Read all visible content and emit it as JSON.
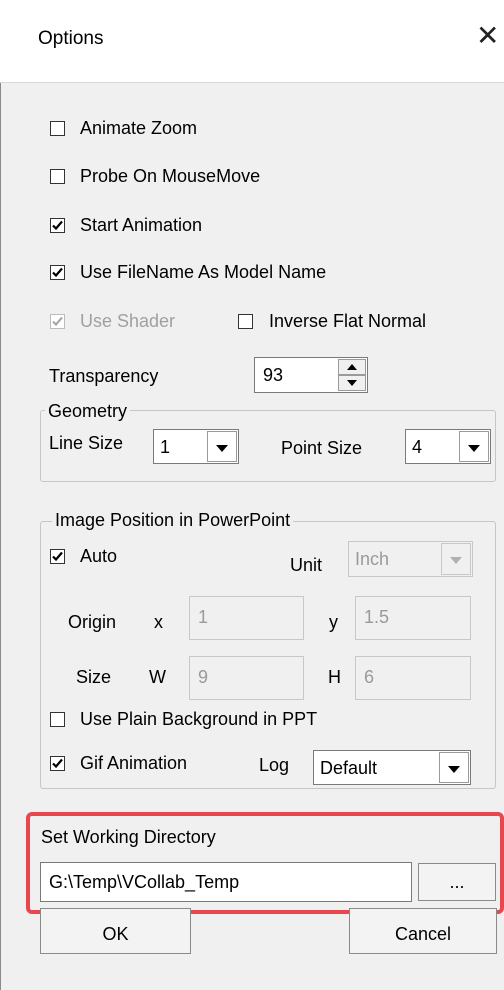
{
  "window": {
    "title": "Options",
    "close_glyph": "✕"
  },
  "checkboxes": {
    "animate_zoom": {
      "label": "Animate Zoom",
      "checked": false
    },
    "probe_on_mousemove": {
      "label": "Probe On MouseMove",
      "checked": false
    },
    "start_animation": {
      "label": "Start Animation",
      "checked": true
    },
    "use_filename": {
      "label": "Use FileName As Model Name",
      "checked": true
    },
    "use_shader": {
      "label": "Use Shader",
      "checked": true,
      "disabled": true
    },
    "inverse_flat_normal": {
      "label": "Inverse Flat Normal",
      "checked": false
    }
  },
  "transparency": {
    "label": "Transparency",
    "value": "93"
  },
  "geometry": {
    "title": "Geometry",
    "line_size_label": "Line Size",
    "line_size_value": "1",
    "point_size_label": "Point Size",
    "point_size_value": "4"
  },
  "image_position": {
    "title": "Image Position in PowerPoint",
    "auto": {
      "label": "Auto",
      "checked": true
    },
    "unit_label": "Unit",
    "unit_value": "Inch",
    "origin_label": "Origin",
    "x_label": "x",
    "x_value": "1",
    "y_label": "y",
    "y_value": "1.5",
    "size_label": "Size",
    "w_label": "W",
    "w_value": "9",
    "h_label": "H",
    "h_value": "6",
    "plain_bg": {
      "label": "Use Plain Background in PPT",
      "checked": false
    },
    "gif_animation": {
      "label": "Gif Animation",
      "checked": true
    },
    "log_label": "Log",
    "log_value": "Default"
  },
  "working_directory": {
    "label": "Set Working Directory",
    "path": "G:\\Temp\\VCollab_Temp",
    "browse_label": "..."
  },
  "buttons": {
    "ok": "OK",
    "cancel": "Cancel"
  },
  "colors": {
    "highlight": "#e8474d",
    "background": "#f0f0f0"
  }
}
